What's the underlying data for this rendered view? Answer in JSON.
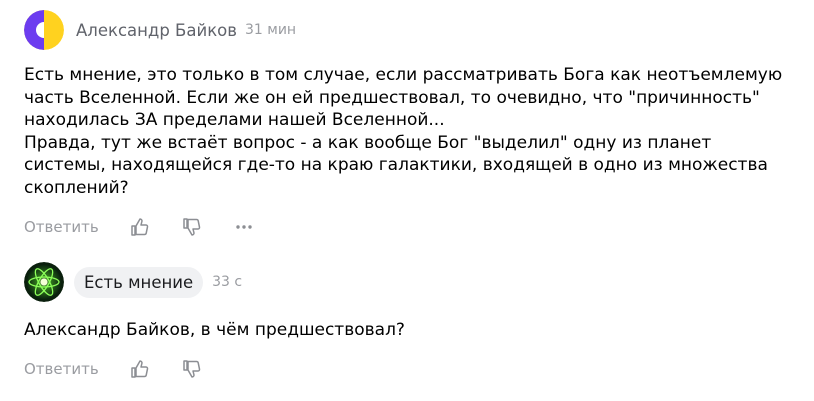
{
  "comments": [
    {
      "author": "Александр Байков",
      "time": "31 мин",
      "text": "Есть мнение, это только в том случае, если рассматривать Бога как неотъемлемую\nчасть Вселенной. Если же он ей предшествовал, то очевидно, что \"причинность\"\nнаходилась ЗА пределами нашей Вселенной...\nПравда, тут же встаёт вопрос - а как вообще Бог \"выделил\" одну из планет\nсистемы, находящейся где-то на краю галактики, входящей в одно из множества\nскоплений?",
      "reply_label": "Ответить",
      "avatar_icon": "yellow-purple-circle-avatar"
    },
    {
      "author": "Есть мнение",
      "time": "33 с",
      "text": "Александр Байков, в чём предшествовал?",
      "reply_label": "Ответить",
      "avatar_icon": "green-atom-avatar"
    }
  ],
  "colors": {
    "muted": "#9a9ca1",
    "author": "#60636b",
    "chip_bg": "#f0f1f3"
  }
}
